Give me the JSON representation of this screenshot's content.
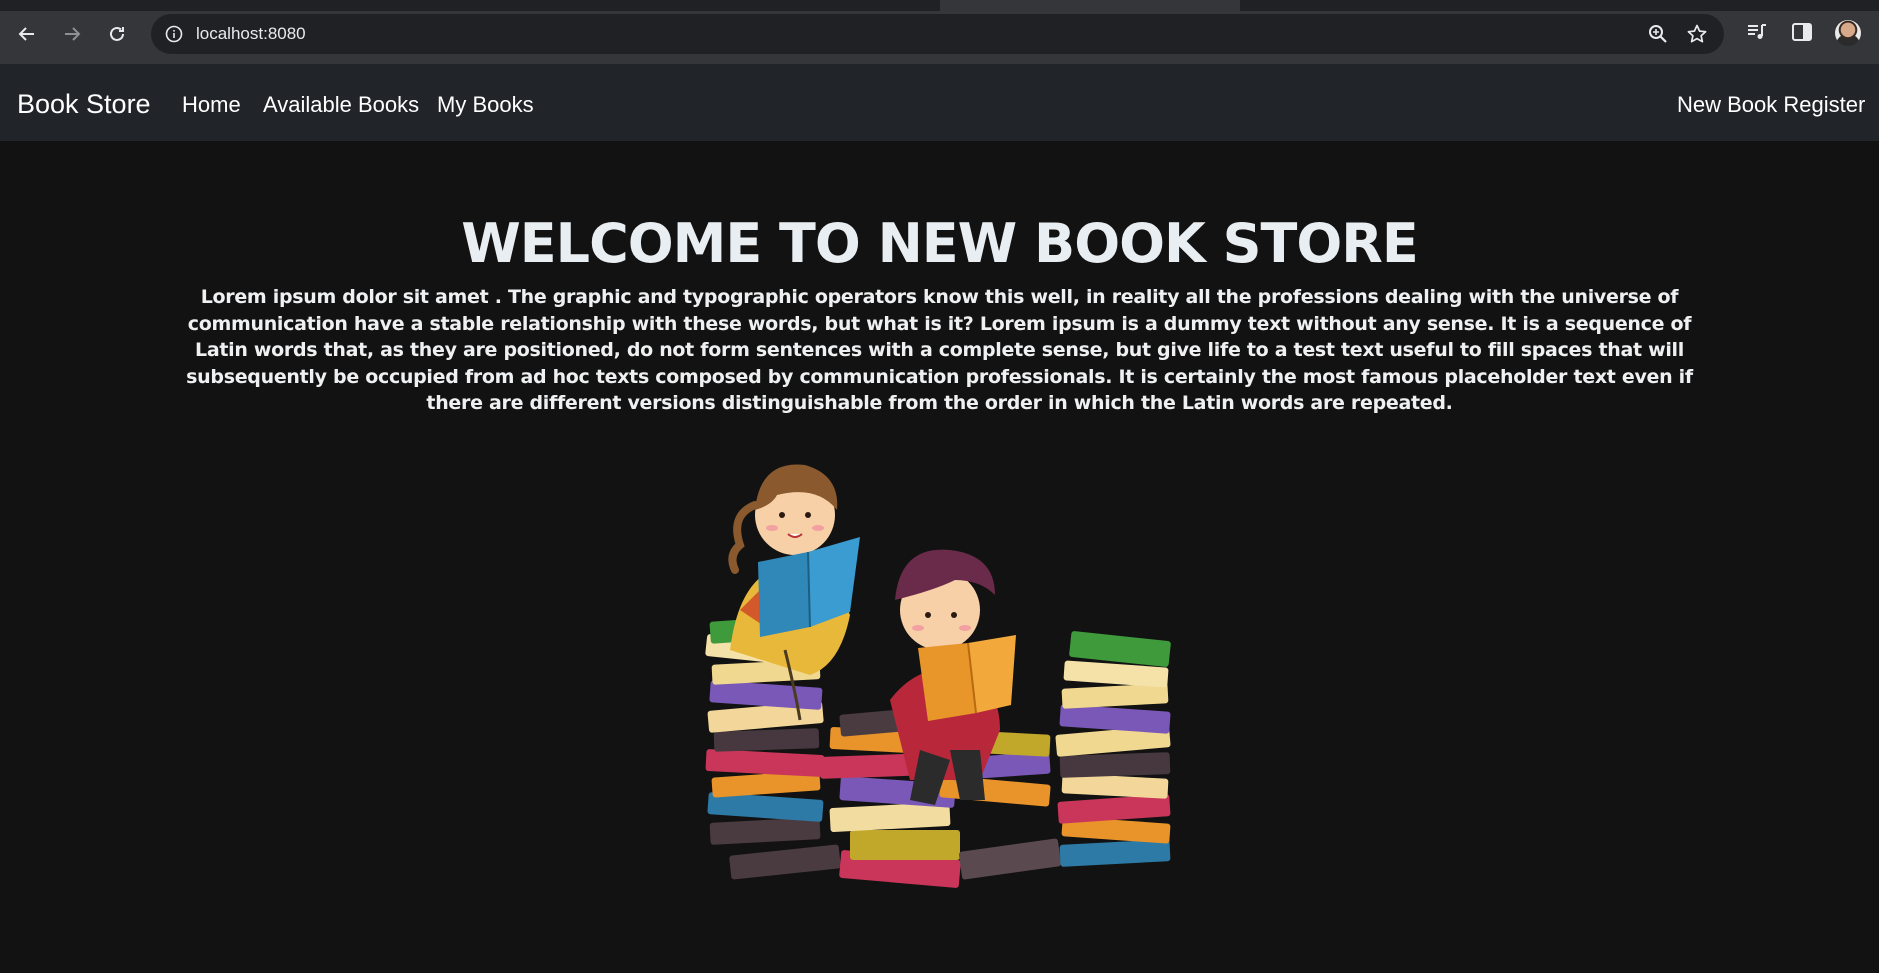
{
  "browser": {
    "url": "localhost:8080",
    "icons": [
      "back-icon",
      "forward-icon",
      "reload-icon",
      "site-info-icon",
      "zoom-icon",
      "bookmark-star-icon",
      "media-icon",
      "side-panel-icon",
      "profile-avatar"
    ]
  },
  "navbar": {
    "brand": "Book Store",
    "links": [
      "Home",
      "Available Books",
      "My Books"
    ],
    "right_link": "New Book Register"
  },
  "hero": {
    "title": "WELCOME TO NEW BOOK STORE",
    "text": "Lorem ipsum dolor sit amet . The graphic and typographic operators know this well, in reality all the professions dealing with the universe of communication have a stable relationship with these words, but what is it? Lorem ipsum is a dummy text without any sense. It is a sequence of Latin words that, as they are positioned, do not form sentences with a complete sense, but give life to a test text useful to fill spaces that will subsequently be occupied from ad hoc texts composed by communication professionals. It is certainly the most famous placeholder text even if there are different versions distinguishable from the order in which the Latin words are repeated."
  },
  "colors": {
    "page_bg": "#121212",
    "navbar_bg": "#212529",
    "chrome_bg": "#35363a"
  }
}
